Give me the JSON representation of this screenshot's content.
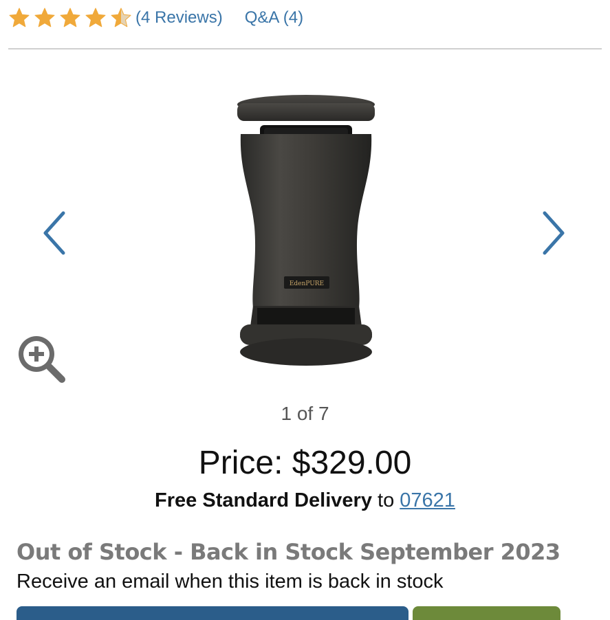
{
  "rating": {
    "stars": 4.5,
    "stars_max": 5,
    "star_color": "#f0a93a",
    "reviews_label": "(4 Reviews)",
    "qa_label": "Q&A (4)"
  },
  "carousel": {
    "counter": "1 of 7",
    "prev_icon": "chevron-left-icon",
    "next_icon": "chevron-right-icon",
    "zoom_icon": "zoom-in-icon",
    "product_logo_text": "EdenPURE"
  },
  "pricing": {
    "price_label": "Price: $329.00"
  },
  "delivery": {
    "strong_text": "Free Standard Delivery",
    "connector": " to ",
    "zip": "07621"
  },
  "availability": {
    "status": "Out of Stock - Back in Stock September 2023",
    "notify_text": "Receive an email when this item is back in stock"
  },
  "colors": {
    "link": "#3a75a8",
    "status_gray": "#7a7a7a",
    "button_blue": "#2b5d8a",
    "button_green": "#6d8a3a"
  }
}
